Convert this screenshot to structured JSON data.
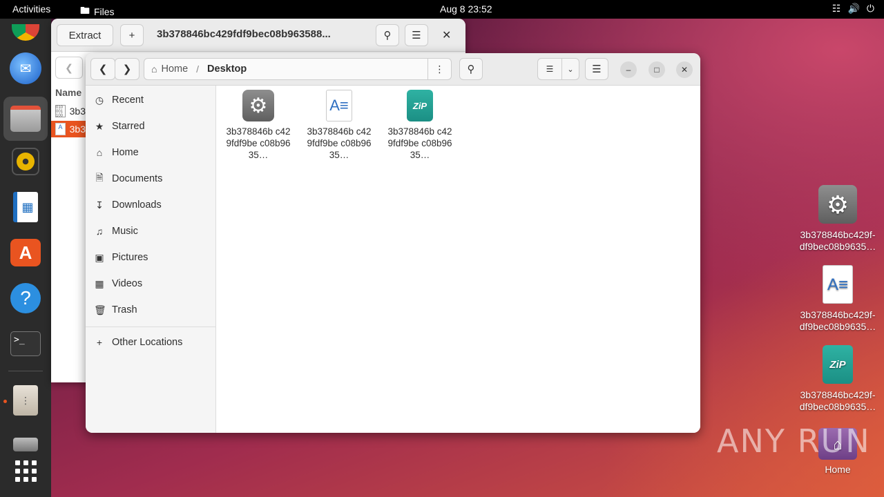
{
  "topbar": {
    "activities": "Activities",
    "app_name": "Files",
    "datetime": "Aug 8  23:52"
  },
  "archive_window": {
    "extract_label": "Extract",
    "add_label": "+",
    "title": "3b378846bc429fdf9bec08b963588...",
    "column_name": "Name",
    "rows": [
      "3b3",
      "3b3"
    ]
  },
  "files_window": {
    "path_home": "Home",
    "path_sep": "/",
    "path_current": "Desktop",
    "sidebar": [
      {
        "label": "Recent",
        "icon": "clock-icon"
      },
      {
        "label": "Starred",
        "icon": "star-icon"
      },
      {
        "label": "Home",
        "icon": "home-icon"
      },
      {
        "label": "Documents",
        "icon": "document-icon"
      },
      {
        "label": "Downloads",
        "icon": "download-icon"
      },
      {
        "label": "Music",
        "icon": "music-icon"
      },
      {
        "label": "Pictures",
        "icon": "picture-icon"
      },
      {
        "label": "Videos",
        "icon": "video-icon"
      },
      {
        "label": "Trash",
        "icon": "trash-icon"
      }
    ],
    "other_locations": "Other Locations",
    "files": [
      {
        "name": "3b378846b c429fdf9be c08b9635…",
        "type": "executable"
      },
      {
        "name": "3b378846b c429fdf9be c08b9635…",
        "type": "document"
      },
      {
        "name": "3b378846b c429fdf9be c08b9635…",
        "type": "zip"
      }
    ]
  },
  "desktop": {
    "icons": [
      {
        "label": "3b378846bc429f-df9bec08b9635…",
        "type": "executable"
      },
      {
        "label": "3b378846bc429f-df9bec08b9635…",
        "type": "document"
      },
      {
        "label": "3b378846bc429f-df9bec08b9635…",
        "type": "zip"
      },
      {
        "label": "Home",
        "type": "home"
      }
    ],
    "watermark": "ANY RUN"
  }
}
